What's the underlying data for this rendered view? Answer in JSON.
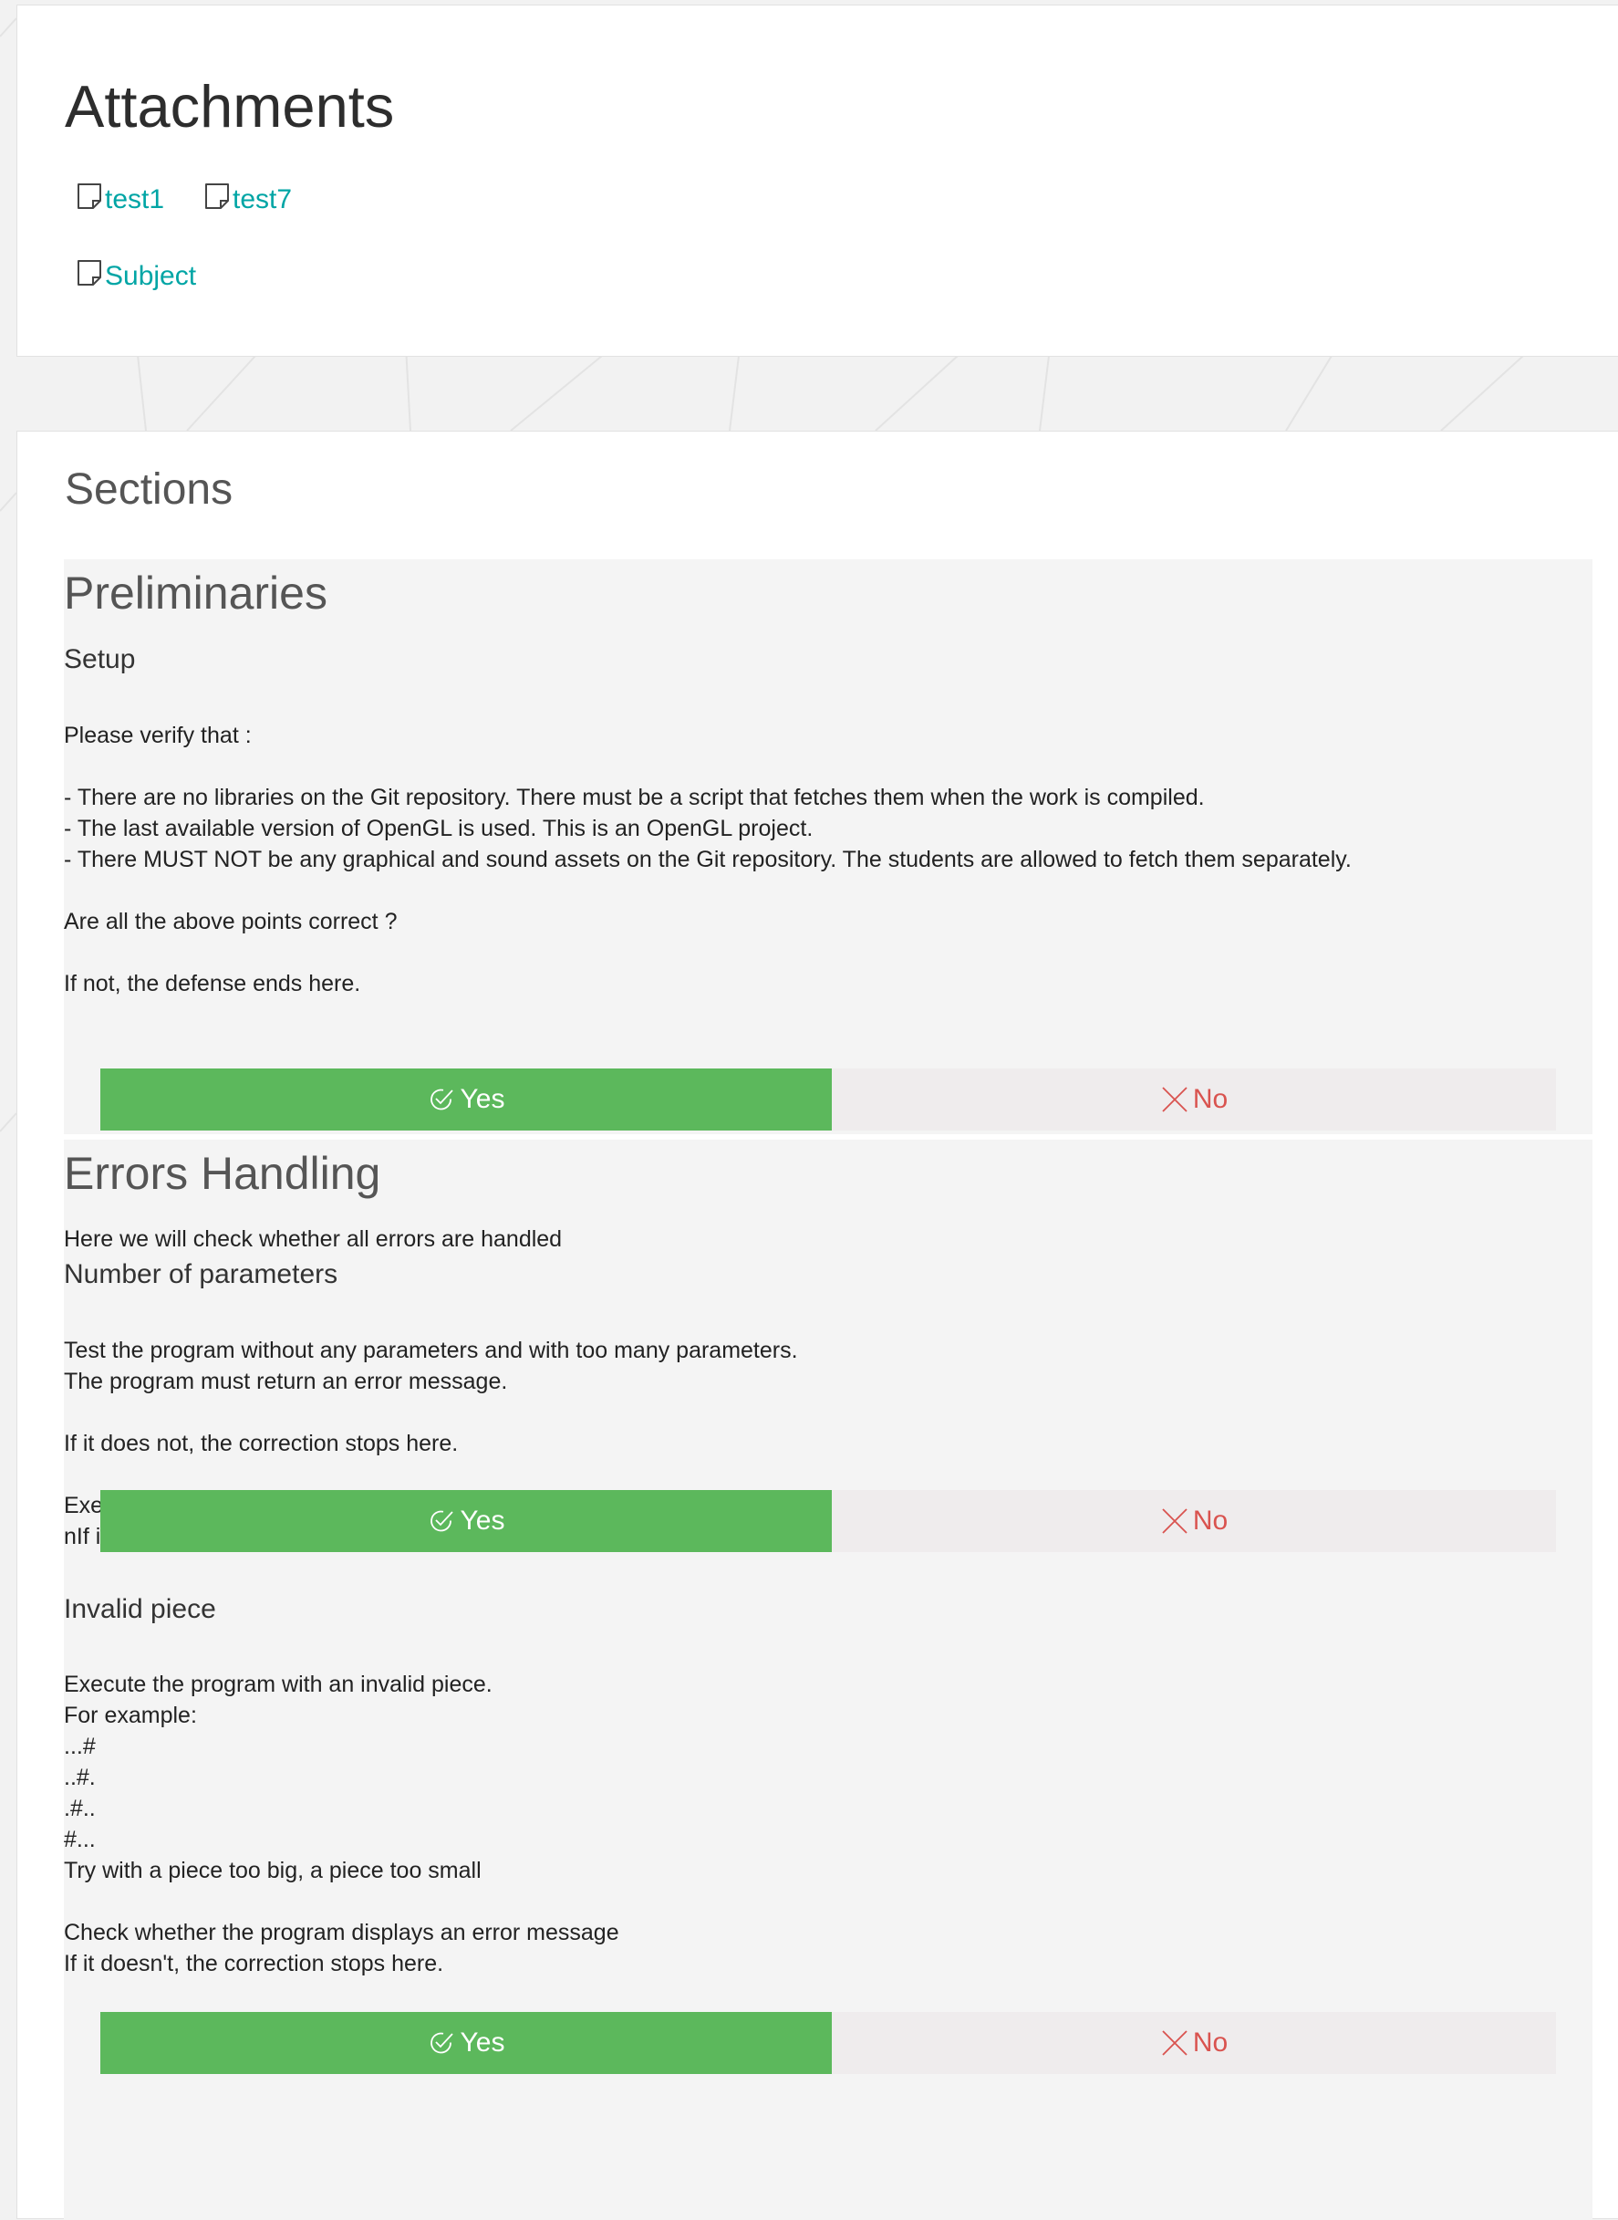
{
  "attachments": {
    "title": "Attachments",
    "files": [
      {
        "label": "test1"
      },
      {
        "label": "test7"
      },
      {
        "label": "Subject"
      }
    ]
  },
  "sections": {
    "title": "Sections",
    "preliminaries": {
      "heading": "Preliminaries",
      "setup": {
        "title": "Setup",
        "text": "Please verify that :\n\n- There are no libraries on the Git repository. There must be a script that fetches them when the work is compiled.\n- The last available version of OpenGL is used. This is an OpenGL project.\n- There MUST NOT be any graphical and sound assets on the Git repository. The students are allowed to fetch them separately.\n\nAre all the above points correct ?\n\nIf not, the defense ends here."
      }
    },
    "errors_handling": {
      "heading": "Errors Handling",
      "intro": "Here we will check whether all errors are handled",
      "number_of_parameters": {
        "title": "Number of parameters",
        "text": "Test the program without any parameters and with too many parameters.\nThe program must return an error message.\n\nIf it does not, the correction stops here.\n\nExecute the program with a valid file as parameter. Does the program outputs as expected?\nnIf it does not, the correction stops here."
      },
      "invalid_piece": {
        "title": "Invalid piece",
        "text": "Execute the program with an invalid piece.\nFor example:\n...#\n..#.\n.#..\n#...\nTry with a piece too big, a piece too small\n\nCheck whether the program displays an error message\nIf it doesn't, the correction stops here."
      }
    },
    "buttons": {
      "yes_label": "Yes",
      "no_label": "No"
    }
  },
  "colors": {
    "accent_link": "#00a5a5",
    "yes_bg": "#5cb85c",
    "no_text": "#d9534f",
    "no_bg": "#efeced"
  },
  "icons": {
    "file": "document-icon",
    "yes": "check-circle-icon",
    "no": "x-icon"
  }
}
